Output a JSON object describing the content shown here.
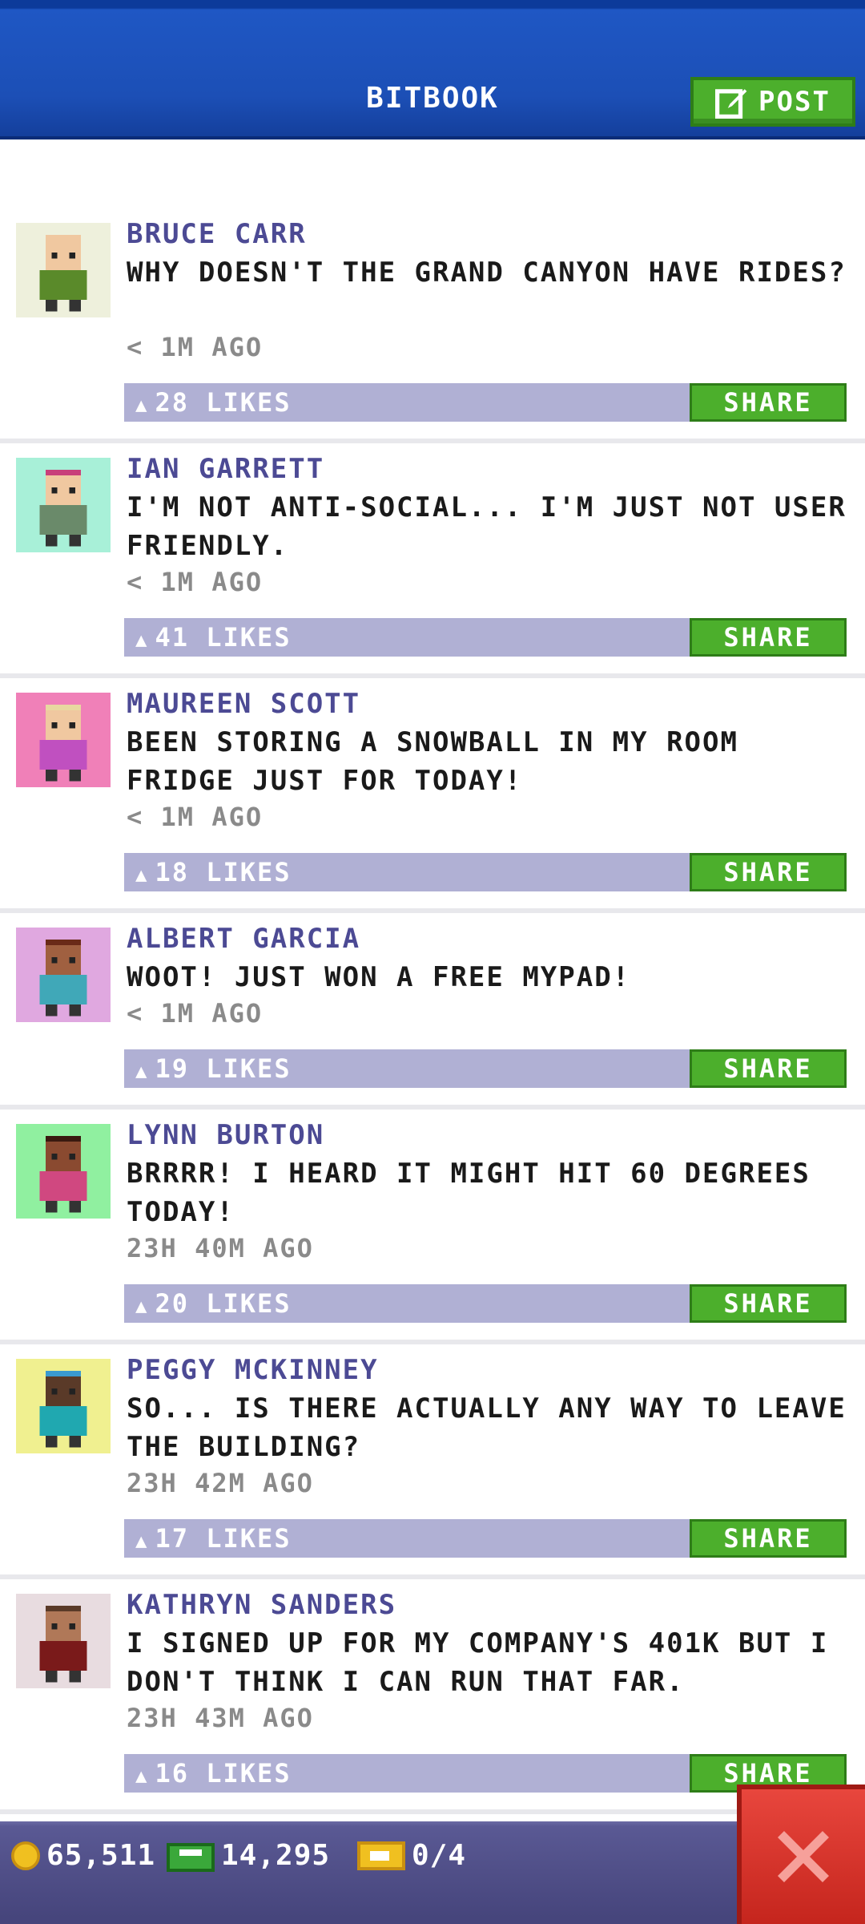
{
  "header": {
    "title": "BITBOOK",
    "post_label": "POST"
  },
  "colors": {
    "header_blue": "#1c4fb6",
    "name_purple": "#4c4a94",
    "like_bar": "#b0b0d4",
    "share_green": "#4caf2c",
    "close_red": "#d93228"
  },
  "feed": [
    {
      "name": "BRUCE CARR",
      "text": "WHY DOESN'T THE GRAND CANYON HAVE RIDES?",
      "time": "< 1M AGO",
      "likes": "28 LIKES",
      "share": "SHARE",
      "avatar_bg": "#eef0dc",
      "skin": "#f0c8a0",
      "shirt": "#5a8a2a",
      "hair": "#f0c8a0"
    },
    {
      "name": "IAN GARRETT",
      "text": "I'M NOT ANTI-SOCIAL... I'M JUST NOT USER FRIENDLY.",
      "time": "< 1M AGO",
      "likes": "41 LIKES",
      "share": "SHARE",
      "avatar_bg": "#a8f0d8",
      "skin": "#f0c8a0",
      "shirt": "#6a8a6a",
      "hair": "#c8407a"
    },
    {
      "name": "MAUREEN SCOTT",
      "text": "BEEN STORING A SNOWBALL IN MY ROOM FRIDGE JUST FOR TODAY!",
      "time": "< 1M AGO",
      "likes": "18 LIKES",
      "share": "SHARE",
      "avatar_bg": "#f080b8",
      "skin": "#f0c8a0",
      "shirt": "#c050c0",
      "hair": "#e8d8a0"
    },
    {
      "name": "ALBERT GARCIA",
      "text": "WOOT! JUST WON A FREE MYPAD!",
      "time": "< 1M AGO",
      "likes": "19 LIKES",
      "share": "SHARE",
      "avatar_bg": "#e0a8e0",
      "skin": "#a06040",
      "shirt": "#40a8b8",
      "hair": "#6a2a18"
    },
    {
      "name": "LYNN BURTON",
      "text": "BRRRR! I HEARD IT MIGHT HIT 60 DEGREES TODAY!",
      "time": "23H 40M AGO",
      "likes": "20 LIKES",
      "share": "SHARE",
      "avatar_bg": "#90f0a0",
      "skin": "#8a4a30",
      "shirt": "#d04880",
      "hair": "#3a1a10"
    },
    {
      "name": "PEGGY MCKINNEY",
      "text": "SO... IS THERE ACTUALLY ANY WAY TO LEAVE THE BUILDING?",
      "time": "23H 42M AGO",
      "likes": "17 LIKES",
      "share": "SHARE",
      "avatar_bg": "#f0f090",
      "skin": "#5a3a28",
      "shirt": "#20a8b0",
      "hair": "#3a9ad0"
    },
    {
      "name": "KATHRYN SANDERS",
      "text": "I SIGNED UP FOR MY COMPANY'S 401K BUT I DON'T THINK I CAN RUN THAT FAR.",
      "time": "23H 43M AGO",
      "likes": "16 LIKES",
      "share": "SHARE",
      "avatar_bg": "#e8dce0",
      "skin": "#b07858",
      "shirt": "#7a1a1a",
      "hair": "#5a3a28"
    }
  ],
  "footer": {
    "coins": "65,511",
    "bux": "14,295",
    "tickets": "0/4"
  }
}
